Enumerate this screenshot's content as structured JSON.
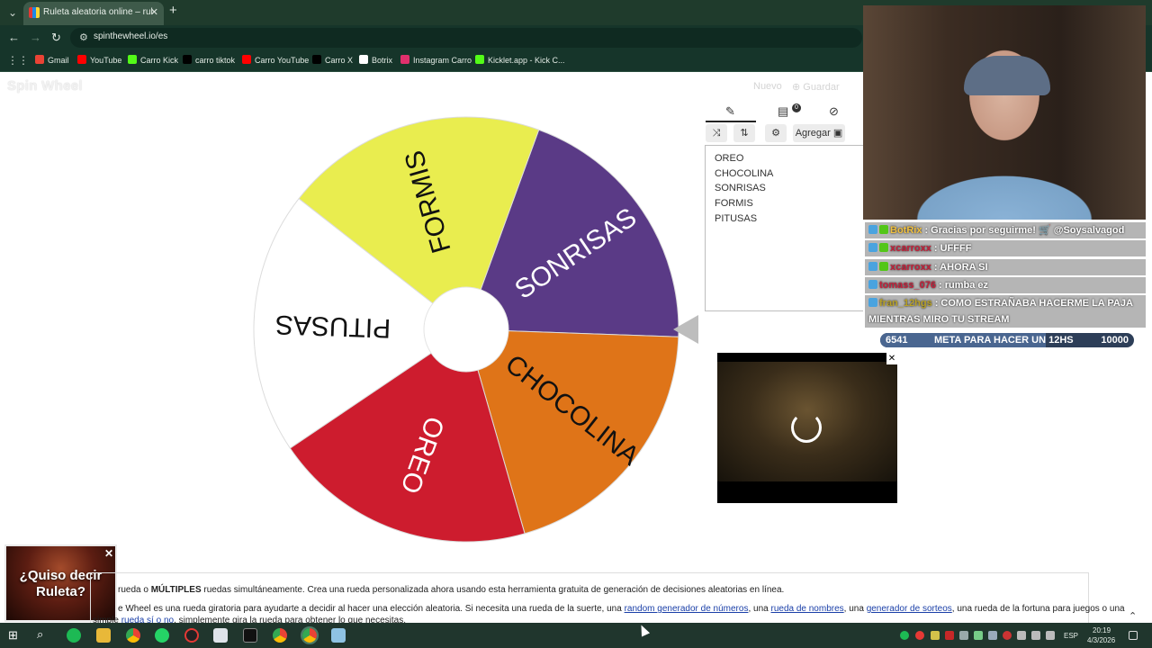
{
  "browser": {
    "tab_title": "Ruleta aleatoria online – rul",
    "tab_close": "✕",
    "new_tab": "+",
    "url": "spinthewheel.io/es",
    "bookmarks": [
      {
        "label": "Gmail",
        "color": "#ea4335"
      },
      {
        "label": "YouTube",
        "color": "#ff0000"
      },
      {
        "label": "Carro Kick",
        "color": "#53fc18"
      },
      {
        "label": "carro tiktok",
        "color": "#000000"
      },
      {
        "label": "Carro YouTube",
        "color": "#ff0000"
      },
      {
        "label": "Carro X",
        "color": "#000000"
      },
      {
        "label": "Botrix",
        "color": "#ffffff"
      },
      {
        "label": "Instagram Carro",
        "color": "#e1306c"
      },
      {
        "label": "Kicklet.app - Kick C...",
        "color": "#53fc18"
      }
    ]
  },
  "site": {
    "logo": "Spin Wheel",
    "nuevo": "Nuevo",
    "guardar": "Guardar"
  },
  "wheel": {
    "segments": [
      {
        "label": "SONRISAS",
        "color": "#5a3a86"
      },
      {
        "label": "CHOCOLINA",
        "color": "#df7418"
      },
      {
        "label": "OREO",
        "color": "#cd1c2e"
      },
      {
        "label": "PITUSAS",
        "color": "#ffffff"
      },
      {
        "label": "FORMIS",
        "color": "#e9ed4f"
      }
    ]
  },
  "editor": {
    "entries_badge": "0",
    "agregar": "Agregar",
    "entries": [
      "OREO",
      "CHOCOLINA",
      "SONRISAS",
      "FORMIS",
      "PITUSAS"
    ]
  },
  "ad": {
    "close": "✕"
  },
  "chat": [
    {
      "user": "BotRix",
      "user_color": "#f0c040",
      "text": ": Gracias por seguirme! 🛒 @Soysalvagod"
    },
    {
      "user": "xcarroxx",
      "user_color": "#c4203a",
      "text": ": UFFFF"
    },
    {
      "user": "xcarroxx",
      "user_color": "#c4203a",
      "text": ": AHORA SI"
    },
    {
      "user": "tomass_076",
      "user_color": "#c4203a",
      "text": ": rumba ez"
    },
    {
      "user": "fran_12hgs",
      "user_color": "#b9a227",
      "text": ": COMO ESTRAÑABA HACERME LA PAJA MIENTRAS MIRO TU STREAM"
    }
  ],
  "goal": {
    "current": "6541",
    "label": "META PARA HACER UN 12HS",
    "target": "10000",
    "progress": 0.6541
  },
  "suggest": {
    "text": "¿Quiso decir Ruleta?",
    "close": "✕"
  },
  "description": {
    "line1_pre": "rueda o ",
    "line1_bold": "MÚLTIPLES",
    "line1_post": " ruedas simultáneamente. Crea una rueda personalizada ahora usando esta herramienta gratuita de generación de decisiones aleatorias en línea.",
    "line2_pre": "e Wheel es una rueda giratoria para ayudarte a decidir al hacer una elección aleatoria. Si necesita una rueda de la suerte, una ",
    "link1": "random generador de números",
    "sep1": ", una ",
    "link2": "rueda de nombres",
    "sep2": ", una ",
    "link3": "generador de sorteos",
    "line2_post": ", una rueda de la fortuna para juegos o una",
    "line3_pre": "simple ",
    "link4": "rueda sí o no",
    "line3_post": ", simplemente gira la rueda para obtener lo que necesitas."
  },
  "taskbar": {
    "lang": "ESP",
    "time": "20:19",
    "date": "4/3/2026"
  }
}
